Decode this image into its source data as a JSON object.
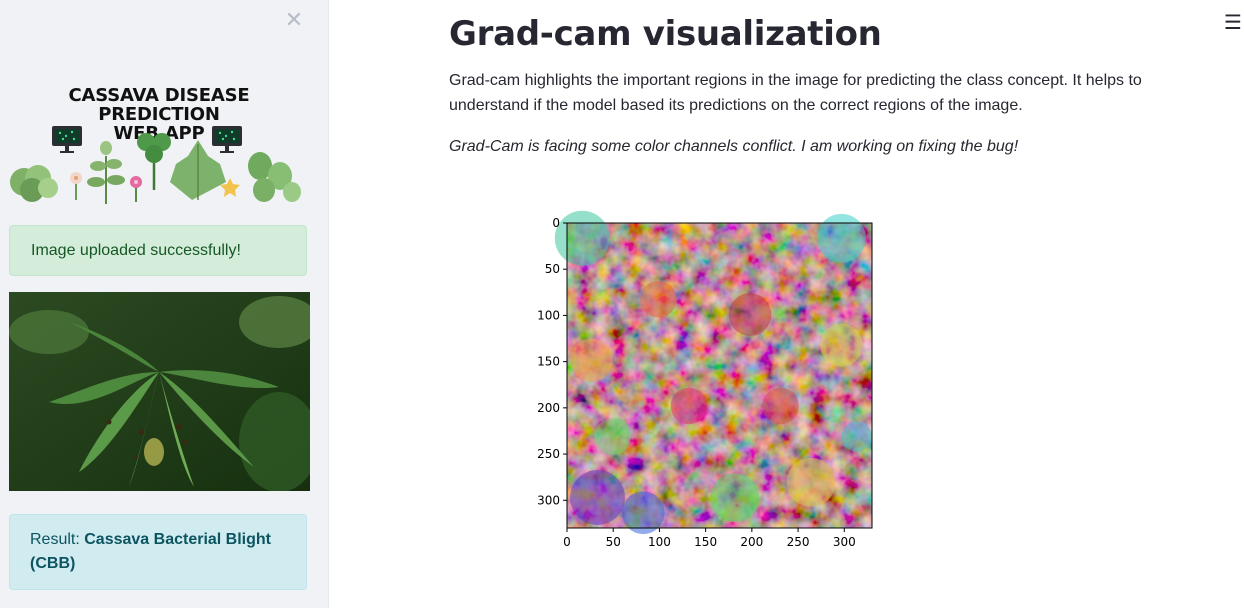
{
  "sidebar": {
    "close_icon": "close-icon",
    "banner_title_line1": "CASSAVA DISEASE PREDICTION",
    "banner_title_line2": "WEB APP",
    "success_message": "Image uploaded successfully!",
    "result_label": "Result:",
    "result_value": "Cassava Bacterial Blight (CBB)"
  },
  "main": {
    "title": "Grad-cam visualization",
    "description": "Grad-cam highlights the important regions in the image for predicting the class concept. It helps to understand if the model based its predictions on the correct regions of the image.",
    "note": "Grad-Cam is facing some color channels conflict. I am working on fixing the bug!",
    "menu_icon": "hamburger-menu-icon"
  },
  "chart_data": {
    "type": "heatmap",
    "title": "",
    "xlabel": "",
    "ylabel": "",
    "xlim": [
      0,
      330
    ],
    "ylim": [
      330,
      0
    ],
    "xticks": [
      0,
      50,
      100,
      150,
      200,
      250,
      300
    ],
    "yticks": [
      0,
      50,
      100,
      150,
      200,
      250,
      300
    ]
  },
  "colors": {
    "sidebar_bg": "#f0f2f6",
    "success_bg": "#d4edda",
    "success_text": "#155724",
    "info_bg": "#d1ecf1",
    "info_text": "#0c5460"
  }
}
